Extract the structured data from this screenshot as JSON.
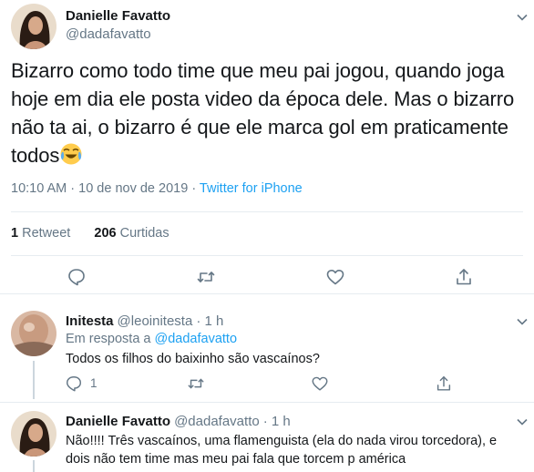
{
  "main_tweet": {
    "author_name": "Danielle Favatto",
    "author_handle": "@dadafavatto",
    "text": "Bizarro como todo time que meu pai jogou, quando joga hoje em dia ele posta video da época dele. Mas o bizarro não ta ai, o bizarro é que ele marca gol em praticamente todos",
    "emoji_icon": "face-with-tears-of-joy-icon",
    "time": "10:10 AM · 10 de nov de 2019 · ",
    "source": "Twitter for iPhone",
    "retweets_count": "1",
    "retweets_label": " Retweet",
    "likes_count": "206",
    "likes_label": " Curtidas"
  },
  "replies": [
    {
      "author_name": "Initesta",
      "author_handle": "@leoinitesta",
      "time": "· 1 h",
      "reply_to_prefix": "Em resposta a ",
      "reply_to_handle": "@dadafavatto",
      "text": "Todos os filhos do baixinho são vascaínos?",
      "reply_count": "1"
    },
    {
      "author_name": "Danielle Favatto",
      "author_handle": "@dadafavatto",
      "time": "· 1 h",
      "text_line1": "Não!!!! Três vascaínos, uma flamenguista (ela do nada virou torcedora), e",
      "text_line2": "dois não tem time mas meu pai fala que torcem p américa"
    }
  ],
  "colors": {
    "accent": "#1da1f2",
    "secondary_text": "#657786",
    "primary_text": "#14171a",
    "divider": "#e6ecf0"
  }
}
